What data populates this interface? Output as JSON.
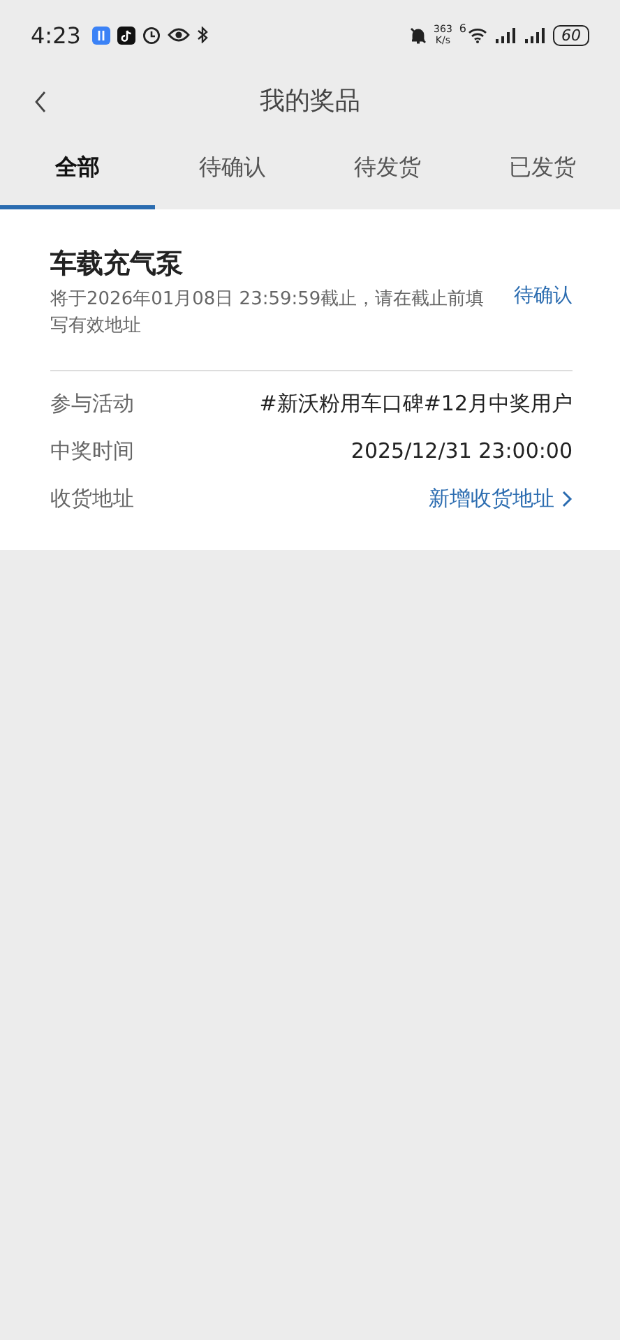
{
  "status_bar": {
    "time": "4:23",
    "speed": "363",
    "speed_unit": "K/s",
    "network": "6",
    "battery": "60"
  },
  "header": {
    "title": "我的奖品"
  },
  "tabs": [
    {
      "label": "全部",
      "selected": true
    },
    {
      "label": "待确认",
      "selected": false
    },
    {
      "label": "待发货",
      "selected": false
    },
    {
      "label": "已发货",
      "selected": false
    }
  ],
  "prize": {
    "name": "车载充气泵",
    "deadline": "将于2026年01月08日 23:59:59截止，请在截止前填写有效地址",
    "status": "待确认",
    "rows": [
      {
        "kind": "text",
        "label": "参与活动",
        "value": "#新沃粉用车口碑#12月中奖用户"
      },
      {
        "kind": "text",
        "label": "中奖时间",
        "value": "2025/12/31 23:00:00"
      },
      {
        "kind": "link",
        "label": "收货地址",
        "value": "新增收货地址"
      }
    ]
  }
}
